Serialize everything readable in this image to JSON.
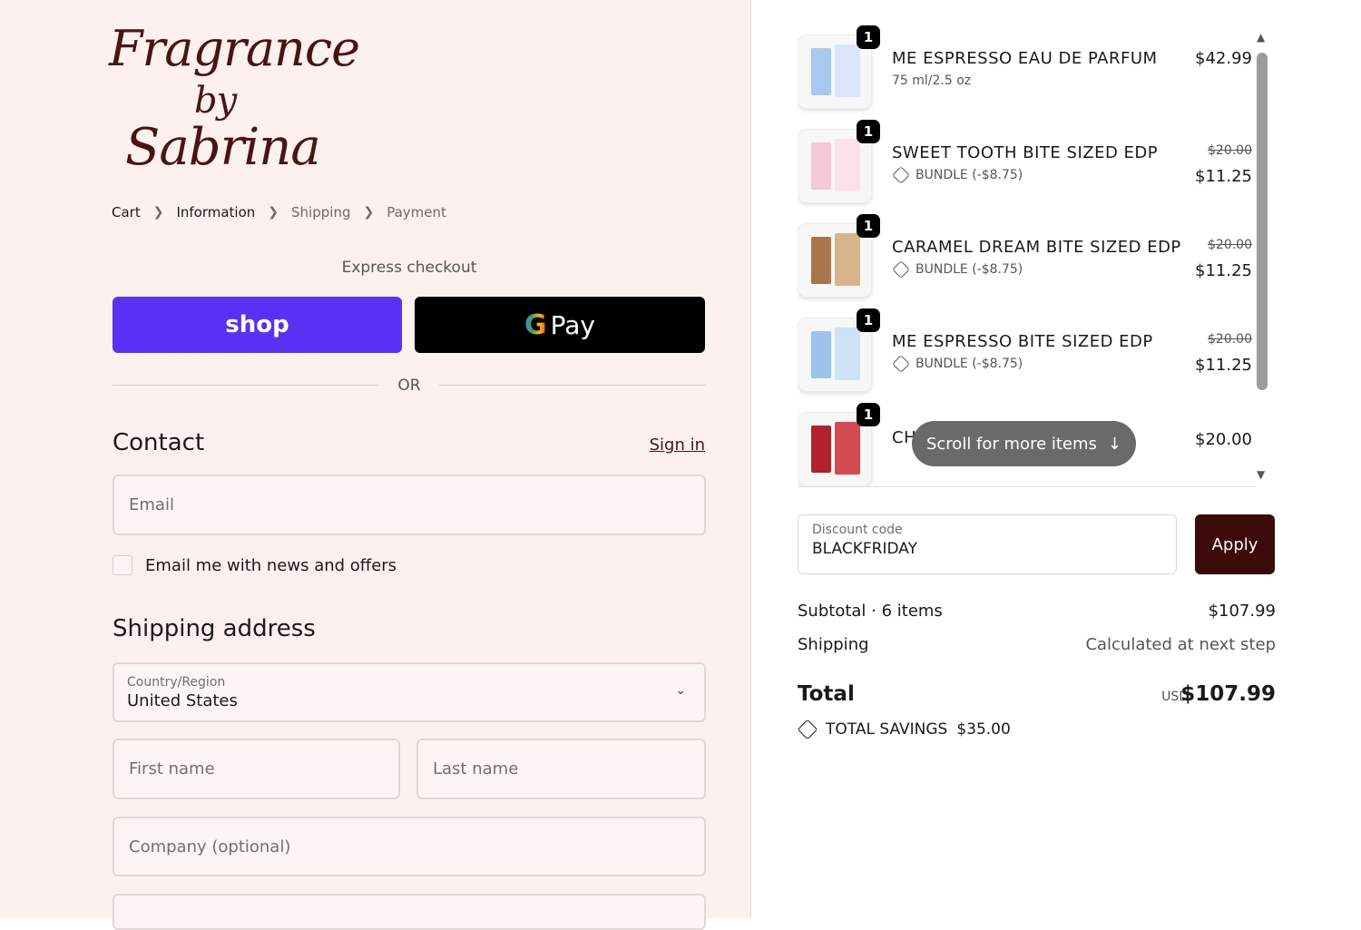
{
  "brand": {
    "logo_line1": "Fragrance",
    "logo_line2": "by",
    "logo_line3": "Sabrina"
  },
  "breadcrumb": [
    {
      "label": "Cart"
    },
    {
      "label": "Information"
    },
    {
      "label": "Shipping"
    },
    {
      "label": "Payment"
    }
  ],
  "express": {
    "label": "Express checkout",
    "shop_label": "shop",
    "gpay_g": "G",
    "gpay_label": "Pay",
    "or_label": "OR"
  },
  "contact": {
    "title": "Contact",
    "sign_in": "Sign in",
    "email_placeholder": "Email",
    "newsletter_label": "Email me with news and offers"
  },
  "shipping_address": {
    "title": "Shipping address",
    "country_label": "Country/Region",
    "country_value": "United States",
    "first_name_placeholder": "First name",
    "last_name_placeholder": "Last name",
    "company_placeholder": "Company (optional)"
  },
  "cart": {
    "items": [
      {
        "qty": "1",
        "name": "ME ESPRESSO EAU DE PARFUM",
        "sub": "75 ml/2.5 oz",
        "old_price": "",
        "price": "$42.99",
        "colors": [
          "#a9c8f0",
          "#d8e6f7"
        ]
      },
      {
        "qty": "1",
        "name": "SWEET TOOTH BITE SIZED EDP",
        "sub": "BUNDLE (-$8.75)",
        "old_price": "$20.00",
        "price": "$11.25",
        "colors": [
          "#f4c9d3",
          "#f9e3e9"
        ]
      },
      {
        "qty": "1",
        "name": "CARAMEL DREAM BITE SIZED EDP",
        "sub": "BUNDLE (-$8.75)",
        "old_price": "$20.00",
        "price": "$11.25",
        "colors": [
          "#a8764a",
          "#d8b48c"
        ]
      },
      {
        "qty": "1",
        "name": "ME ESPRESSO BITE SIZED EDP",
        "sub": "BUNDLE (-$8.75)",
        "old_price": "$20.00",
        "price": "$11.25",
        "colors": [
          "#9cc2ee",
          "#cfe1f6"
        ]
      },
      {
        "qty": "1",
        "name": "CH",
        "sub": "",
        "old_price": "",
        "price": "$20.00",
        "colors": [
          "#b3212e",
          "#d44a52"
        ]
      }
    ],
    "scroll_pill": "Scroll for more items",
    "scroll_arrow": "↓"
  },
  "discount": {
    "label": "Discount code",
    "value": "BLACKFRIDAY",
    "apply_label": "Apply"
  },
  "summary": {
    "subtotal_label": "Subtotal · 6 items",
    "subtotal_value": "$107.99",
    "shipping_label": "Shipping",
    "shipping_value": "Calculated at next step",
    "total_label": "Total",
    "currency": "USD",
    "total_value": "$107.99",
    "savings_label": "TOTAL SAVINGS",
    "savings_value": "$35.00"
  },
  "colors": {
    "left_bg": "#fcf1ef",
    "shop_purple": "#5a31f4",
    "apply_maroon": "#3d0a0a",
    "logo_brown": "#4a1414"
  }
}
